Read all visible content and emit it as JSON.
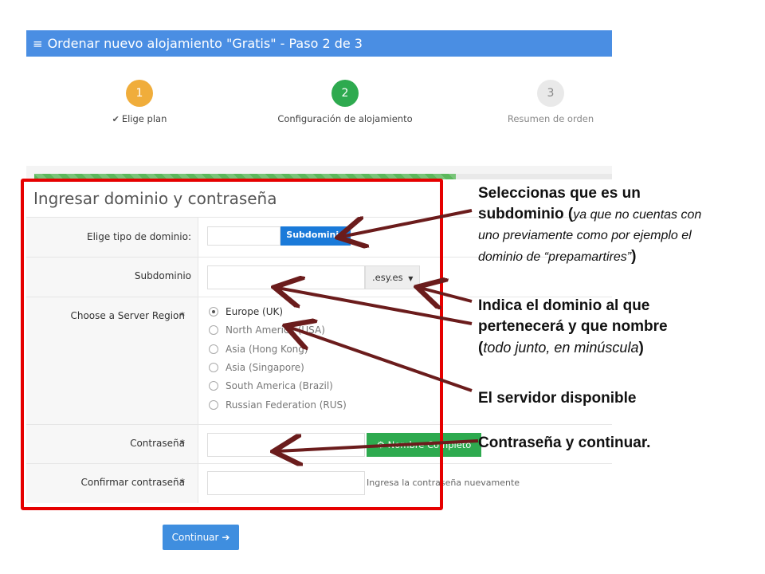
{
  "header": {
    "menu_icon": "hamburger-icon",
    "title": "Ordenar nuevo alojamiento \"Gratis\" - Paso 2 de 3"
  },
  "steps": [
    {
      "number": "1",
      "label": "Elige plan",
      "state": "done",
      "color": "#f0ad3b"
    },
    {
      "number": "2",
      "label": "Configuración de alojamiento",
      "state": "active",
      "color": "#2eaa4f"
    },
    {
      "number": "3",
      "label": "Resumen de orden",
      "state": "pending",
      "color": "#e9e9e9"
    }
  ],
  "progress": {
    "fraction": 0.73,
    "color": "#5cb85c"
  },
  "form": {
    "title": "Ingresar dominio y contraseña",
    "domain_type": {
      "label": "Elige tipo de dominio:",
      "button": "Subdominio"
    },
    "subdomain": {
      "label": "Subdominio",
      "value": "",
      "suffix": ".esy.es",
      "suffix_icon": "caret-down-icon"
    },
    "region": {
      "label": "Choose a Server Region",
      "required_mark": "*",
      "options": [
        {
          "label": "Europe (UK)",
          "checked": true
        },
        {
          "label": "North America (USA)",
          "checked": false
        },
        {
          "label": "Asia (Hong Kong)",
          "checked": false
        },
        {
          "label": "Asia (Singapore)",
          "checked": false
        },
        {
          "label": "South America (Brazil)",
          "checked": false
        },
        {
          "label": "Russian Federation (RUS)",
          "checked": false
        }
      ]
    },
    "password": {
      "label": "Contraseña",
      "required_mark": "*",
      "value": "",
      "generate_button": "Nombre Completo",
      "generate_icon": "gear-icon"
    },
    "confirm": {
      "label": "Confirmar contraseña",
      "required_mark": "*",
      "value": "",
      "help": "Ingresa la contraseña nuevamente"
    },
    "continue_button": "Continuar",
    "continue_icon": "arrow-circle-right-icon"
  },
  "annotations": {
    "box_color": "#e60000",
    "arrow_color": "#6b1c1c",
    "note1": {
      "line1": "Seleccionas que es un",
      "line2_bold": "subdominio (",
      "line2_italic": "ya que no cuentas con",
      "line3_italic": "uno previamente como por ejemplo el",
      "line4_italic": "dominio de “prepamartires”",
      "line4_close": ")"
    },
    "note2": {
      "line1": "Indica el dominio al que",
      "line2": "pertenecerá y que nombre",
      "line3_open": "(",
      "line3_italic": "todo junto, en minúscula",
      "line3_close": ")"
    },
    "note3": "El servidor disponible",
    "note4": "Contraseña y continuar."
  }
}
